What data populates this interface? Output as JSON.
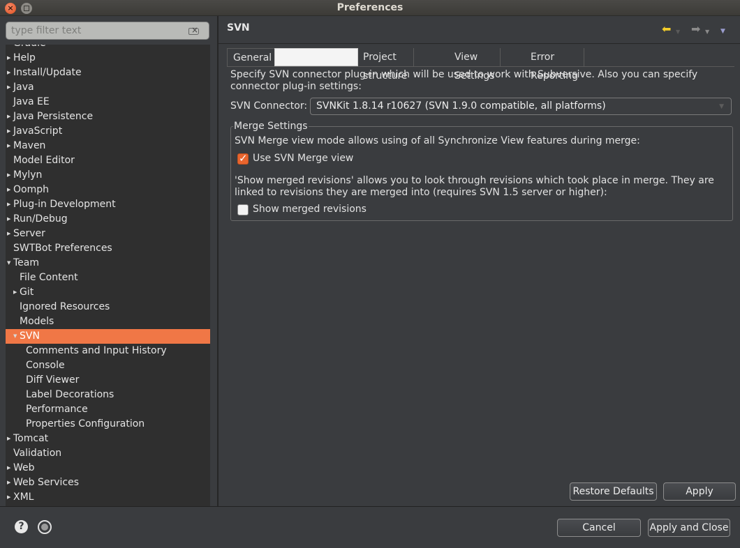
{
  "window": {
    "title": "Preferences"
  },
  "filter": {
    "placeholder": "type filter text"
  },
  "tree": [
    {
      "label": "Gradle",
      "level": 0,
      "arrow": ""
    },
    {
      "label": "Help",
      "level": 0,
      "arrow": "▶"
    },
    {
      "label": "Install/Update",
      "level": 0,
      "arrow": "▶"
    },
    {
      "label": "Java",
      "level": 0,
      "arrow": "▶"
    },
    {
      "label": "Java EE",
      "level": 0,
      "arrow": ""
    },
    {
      "label": "Java Persistence",
      "level": 0,
      "arrow": "▶"
    },
    {
      "label": "JavaScript",
      "level": 0,
      "arrow": "▶"
    },
    {
      "label": "Maven",
      "level": 0,
      "arrow": "▶"
    },
    {
      "label": "Model Editor",
      "level": 0,
      "arrow": ""
    },
    {
      "label": "Mylyn",
      "level": 0,
      "arrow": "▶"
    },
    {
      "label": "Oomph",
      "level": 0,
      "arrow": "▶"
    },
    {
      "label": "Plug-in Development",
      "level": 0,
      "arrow": "▶"
    },
    {
      "label": "Run/Debug",
      "level": 0,
      "arrow": "▶"
    },
    {
      "label": "Server",
      "level": 0,
      "arrow": "▶"
    },
    {
      "label": "SWTBot Preferences",
      "level": 0,
      "arrow": ""
    },
    {
      "label": "Team",
      "level": 0,
      "arrow": "▼"
    },
    {
      "label": "File Content",
      "level": 1,
      "arrow": ""
    },
    {
      "label": "Git",
      "level": 1,
      "arrow": "▶"
    },
    {
      "label": "Ignored Resources",
      "level": 1,
      "arrow": ""
    },
    {
      "label": "Models",
      "level": 1,
      "arrow": ""
    },
    {
      "label": "SVN",
      "level": 1,
      "arrow": "▼",
      "selected": true
    },
    {
      "label": "Comments and Input History",
      "level": 2,
      "arrow": ""
    },
    {
      "label": "Console",
      "level": 2,
      "arrow": ""
    },
    {
      "label": "Diff Viewer",
      "level": 2,
      "arrow": ""
    },
    {
      "label": "Label Decorations",
      "level": 2,
      "arrow": ""
    },
    {
      "label": "Performance",
      "level": 2,
      "arrow": ""
    },
    {
      "label": "Properties Configuration",
      "level": 2,
      "arrow": ""
    },
    {
      "label": "Tomcat",
      "level": 0,
      "arrow": "▶"
    },
    {
      "label": "Validation",
      "level": 0,
      "arrow": ""
    },
    {
      "label": "Web",
      "level": 0,
      "arrow": "▶"
    },
    {
      "label": "Web Services",
      "level": 0,
      "arrow": "▶"
    },
    {
      "label": "XML",
      "level": 0,
      "arrow": "▶"
    }
  ],
  "page": {
    "title": "SVN",
    "tabs": [
      "General",
      "",
      "Project structure",
      "View Settings",
      "Error Reporting"
    ],
    "description": "Specify SVN connector plug-in which will be used to work with Subversive. Also you can specify connector plug-in settings:",
    "connector_label": "SVN Connector:",
    "connector_value": "SVNKit 1.8.14 r10627 (SVN 1.9.0 compatible, all platforms)",
    "merge": {
      "title": "Merge Settings",
      "desc1": "SVN Merge view mode allows using of all Synchronize View features during merge:",
      "use_merge_label": "Use SVN Merge view",
      "use_merge_checked": true,
      "desc2": "'Show merged revisions' allows you to look through revisions which took place in merge. They are linked to revisions they are merged into (requires SVN 1.5 server or higher):",
      "show_merged_label": "Show merged revisions",
      "show_merged_checked": false
    },
    "restore_label": "Restore Defaults",
    "apply_label": "Apply"
  },
  "footer": {
    "cancel_label": "Cancel",
    "apply_close_label": "Apply and Close"
  }
}
